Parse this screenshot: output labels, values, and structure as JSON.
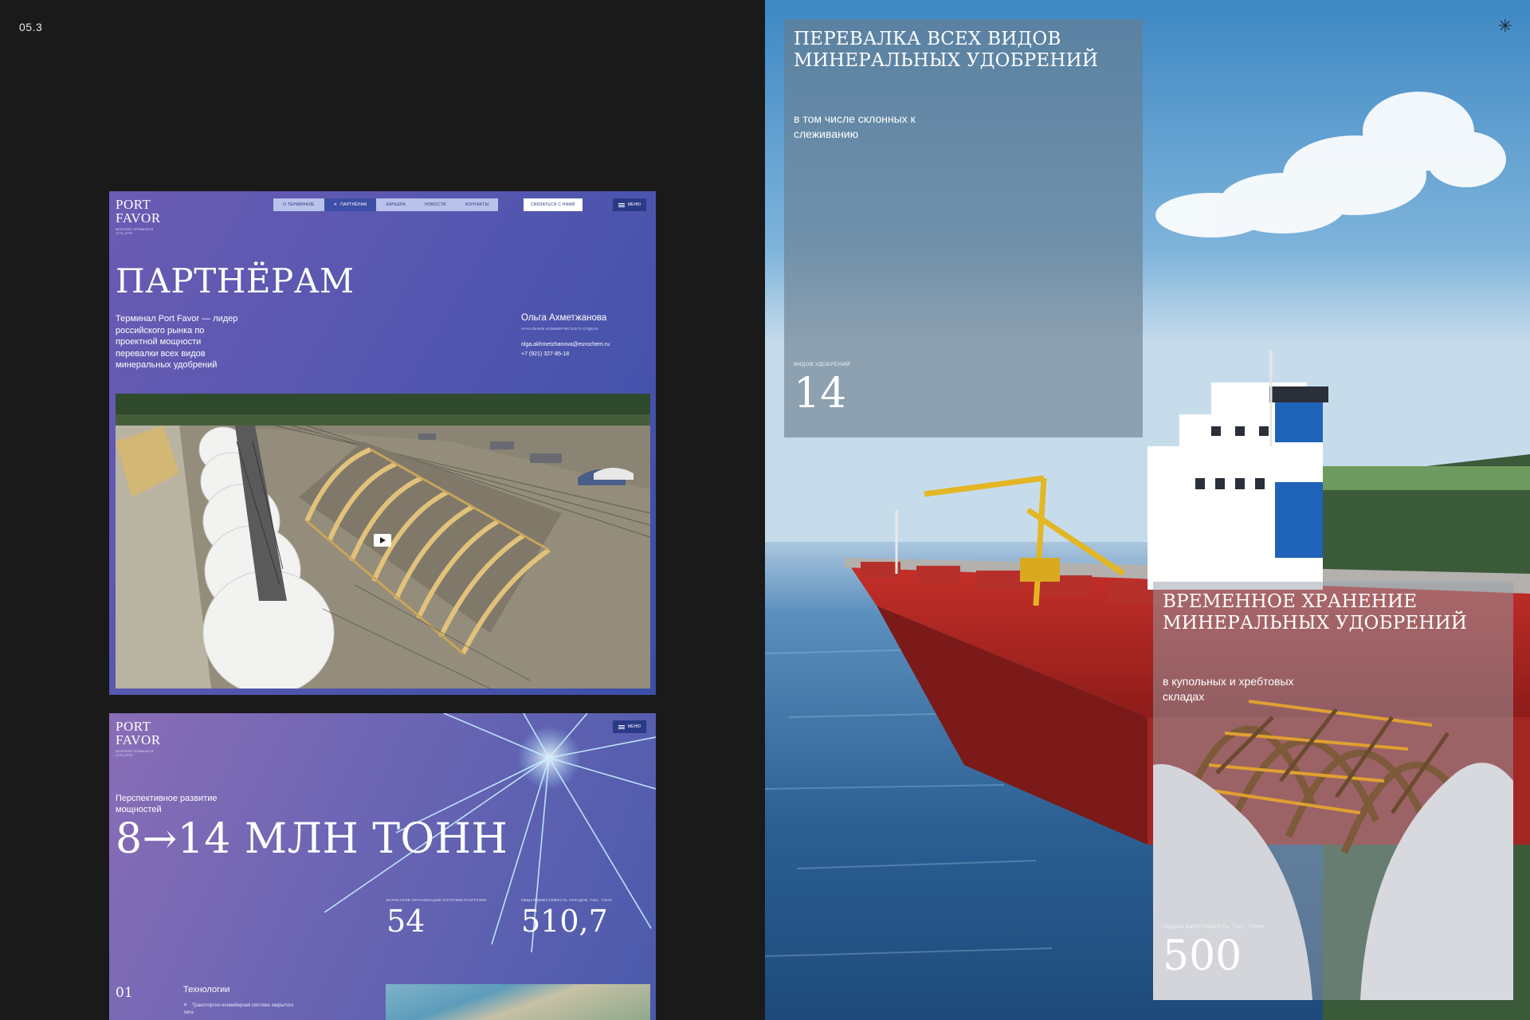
{
  "slide": {
    "number": "05.3"
  },
  "brand": {
    "logo_line1": "PORT",
    "logo_line2": "FAVOR",
    "logo_sub": "МОРСКОЙ ТЕРМИНАЛ В УСТЬ-ЛУГЕ"
  },
  "mock1": {
    "nav": [
      {
        "label": "О ТЕРМИНАЛЕ",
        "active": false
      },
      {
        "label": "ПАРТНЁРАМ",
        "active": true
      },
      {
        "label": "КАРЬЕРА",
        "active": false
      },
      {
        "label": "НОВОСТИ",
        "active": false
      },
      {
        "label": "КОНТАКТЫ",
        "active": false
      }
    ],
    "contact_button": "СВЯЗАТЬСЯ С НАМИ",
    "menu_button": "МЕНЮ",
    "title": "ПАРТНЁРАМ",
    "lead": "Терминал Port Favor — лидер российского рынка по проектной мощности перевалки всех видов минеральных удобрений",
    "person": {
      "name": "Ольга Ахметжанова",
      "role": "НАЧАЛЬНИК КОММЕРЧЕСКОГО ОТДЕЛА",
      "email": "olga.akhmetzhanova@eurochem.ru",
      "phone": "+7 (921) 327-85-18"
    }
  },
  "mock2": {
    "menu_button": "МЕНЮ",
    "lead": "Перспективное развитие мощностей",
    "big_value": "8→14 МЛН ТОНН",
    "stats": [
      {
        "caption": "ВАРИАНТОВ ОРГАНИЗАЦИИ ПОГРУЗКИ-РАЗГРУЗКИ",
        "value": "54"
      },
      {
        "caption": "ОБЩАЯ ВМЕСТИМОСТЬ СКЛАДОВ, ТЫС. ТОНН",
        "value": "510,7"
      }
    ],
    "section_number": "01",
    "section_title": "Технологии",
    "section_item": "Транспортно-конвейерная система закрытого типа"
  },
  "card1": {
    "title": "ПЕРЕВАЛКА ВСЕХ ВИДОВ МИНЕРАЛЬНЫХ УДОБРЕНИЙ",
    "desc": "в том числе склонных к слеживанию",
    "caption": "ВИДОВ УДОБРЕНИЙ",
    "value": "14"
  },
  "card2": {
    "title": "ВРЕМЕННОЕ ХРАНЕНИЕ МИНЕРАЛЬНЫХ УДОБРЕНИЙ",
    "desc": "в купольных и хребтовых складах",
    "caption": "ОБЩАЯ ВМЕСТИМОСТЬ, ТЫС. ТОНН",
    "value": "500"
  },
  "icons": {
    "corner": "star-icon",
    "play": "play-icon",
    "menu": "burger-icon",
    "item": "sparkle-icon"
  }
}
